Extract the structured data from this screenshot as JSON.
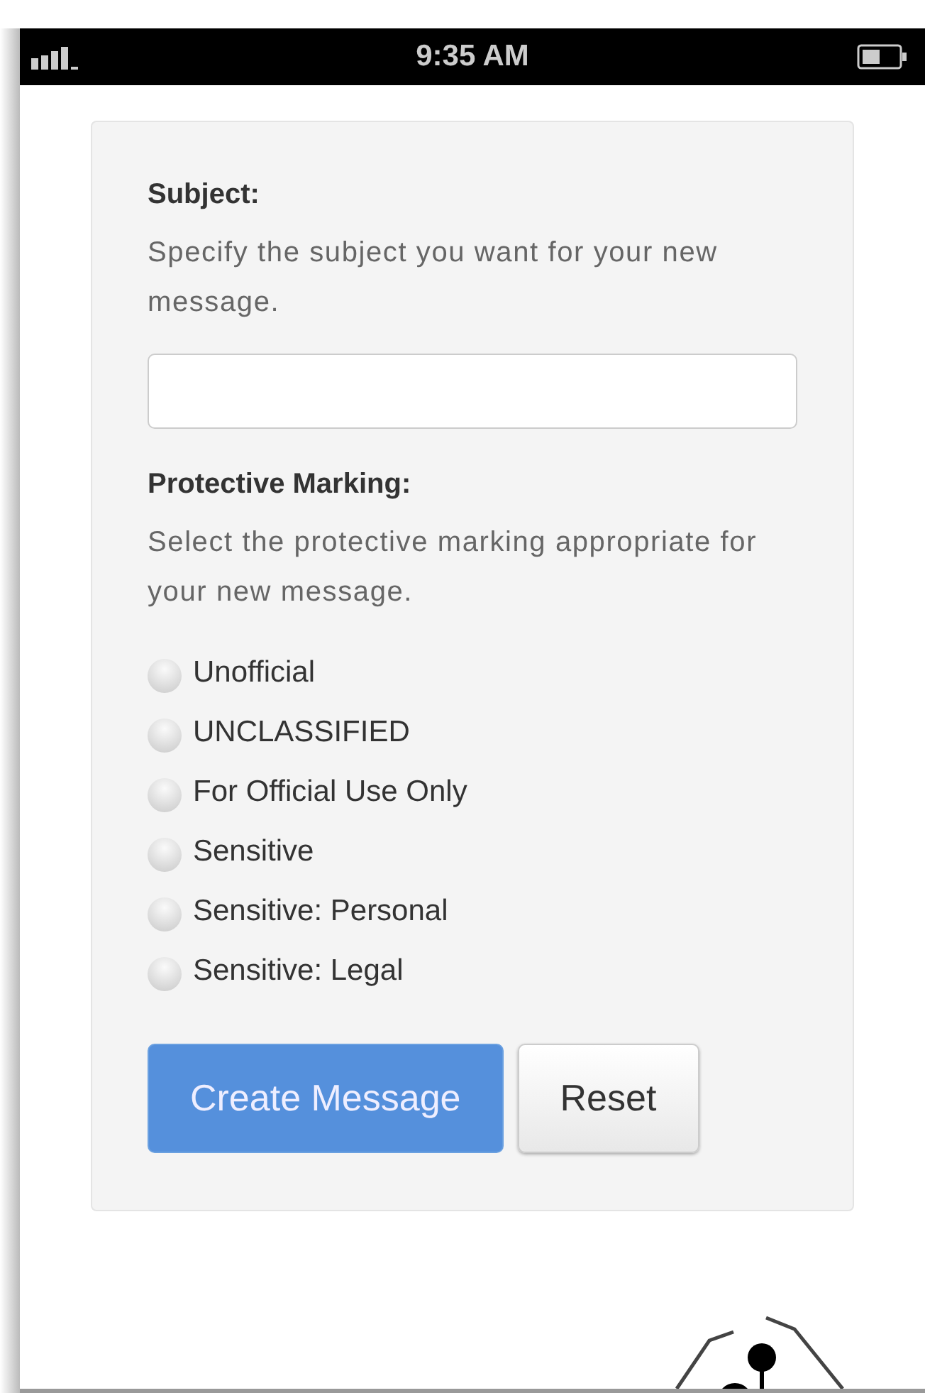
{
  "status_bar": {
    "time": "9:35 AM"
  },
  "form": {
    "subject": {
      "label": "Subject:",
      "help": "Specify the subject you want for your new message."
    },
    "marking": {
      "label": "Protective Marking:",
      "help": "Select the protective marking appropriate for your new message.",
      "options": [
        {
          "label": "Unofficial",
          "selected": false
        },
        {
          "label": "UNCLASSIFIED",
          "selected": false
        },
        {
          "label": "For Official Use Only",
          "selected": false
        },
        {
          "label": "Sensitive",
          "selected": false
        },
        {
          "label": "Sensitive: Personal",
          "selected": false
        },
        {
          "label": "Sensitive: Legal",
          "selected": false
        }
      ]
    },
    "buttons": [
      {
        "label": "Create Message",
        "kind": "primary"
      },
      {
        "label": "Reset",
        "kind": "secondary"
      }
    ]
  }
}
